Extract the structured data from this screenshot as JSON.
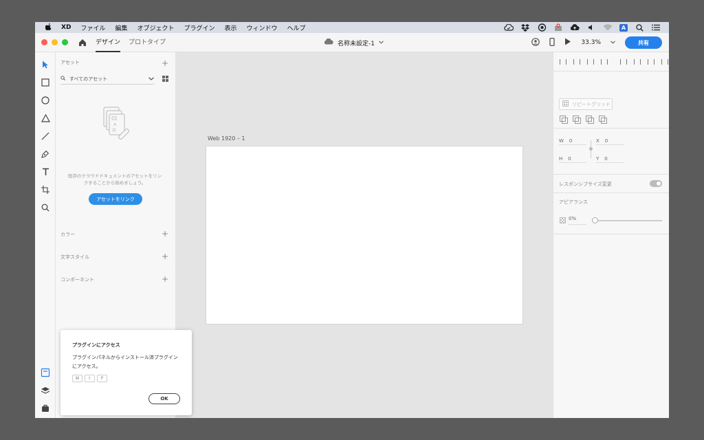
{
  "menubar": {
    "app": "XD",
    "items": [
      "ファイル",
      "編集",
      "オブジェクト",
      "プラグイン",
      "表示",
      "ウィンドウ",
      "ヘルプ"
    ],
    "status_icons": [
      "creative-cloud-icon",
      "dropbox-icon",
      "sync-icon",
      "alert-icon",
      "cloud-upload-icon",
      "volume-icon",
      "wifi-icon",
      "input-source-icon",
      "spotlight-icon",
      "control-center-icon"
    ],
    "input_source": "A"
  },
  "titlebar": {
    "tabs": [
      "デザイン",
      "プロトタイプ"
    ],
    "doc_title": "名称未設定-1",
    "zoom": "33.3%",
    "share": "共有"
  },
  "assets": {
    "header": "アセット",
    "search_label": "すべてのアセット",
    "empty_text": "既存のクラウドドキュメントのアセットをリンクすることから始めましょう。",
    "link_button": "アセットをリンク",
    "sections": [
      "カラー",
      "文字スタイル",
      "コンポーネント"
    ]
  },
  "canvas": {
    "artboard_label": "Web 1920 – 1"
  },
  "properties": {
    "repeat_grid": "リピートグリッド",
    "w_label": "W",
    "w_value": "0",
    "h_label": "H",
    "h_value": "0",
    "x_label": "X",
    "x_value": "0",
    "y_label": "Y",
    "y_value": "0",
    "responsive_resize": "レスポンシブサイズ変更",
    "appearance": "アピアランス",
    "opacity": "0%"
  },
  "popup": {
    "title": "プラグインにアクセス",
    "body": "プラグインパネルからインストール済プラグインにアクセス。",
    "keys": [
      "⌘",
      "⇧",
      "P"
    ],
    "ok": "OK"
  },
  "colors": {
    "accent": "#2680eb",
    "canvas": "#e4e4e4",
    "menubar": "#d9dde6"
  }
}
